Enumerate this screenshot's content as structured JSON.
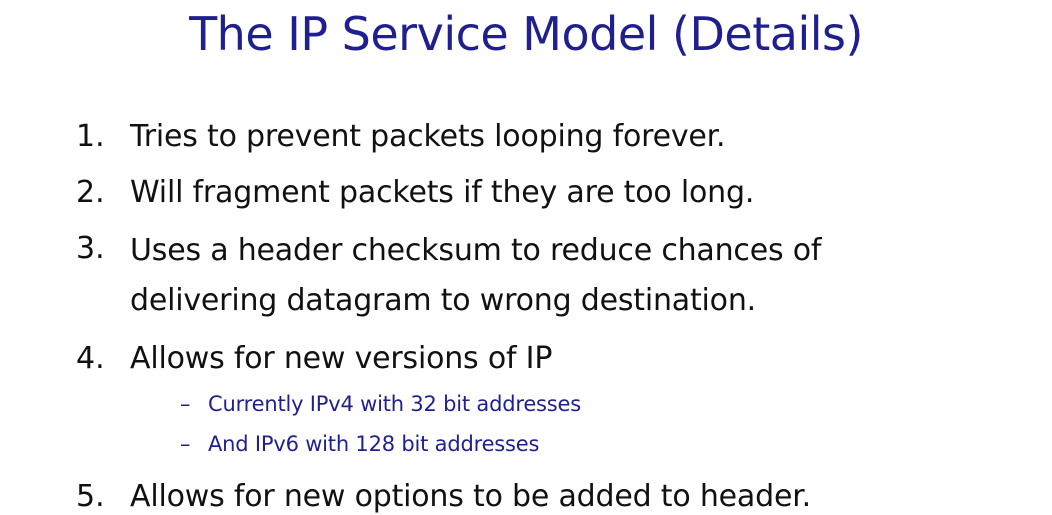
{
  "slide": {
    "title": "The IP Service Model (Details)"
  },
  "items": [
    {
      "number": "1.",
      "lines": [
        "Tries to prevent packets looping forever."
      ]
    },
    {
      "number": "2.",
      "lines": [
        "Will fragment packets if they are too long."
      ]
    },
    {
      "number": "3.",
      "lines": [
        "Uses a header checksum to reduce chances of",
        "delivering datagram to wrong destination."
      ]
    },
    {
      "number": "4.",
      "lines": [
        "Allows for new versions of IP"
      ],
      "subitems": [
        {
          "dash": "–",
          "text": "Currently IPv4 with 32 bit addresses"
        },
        {
          "dash": "–",
          "text": "And IPv6 with 128 bit addresses"
        }
      ]
    },
    {
      "number": "5.",
      "lines": [
        "Allows for new options to be added to header."
      ]
    }
  ],
  "colors": {
    "title": "#1f1f8f",
    "body_text": "#111111",
    "subitem_text": "#1f1f8f",
    "background": "#ffffff"
  }
}
